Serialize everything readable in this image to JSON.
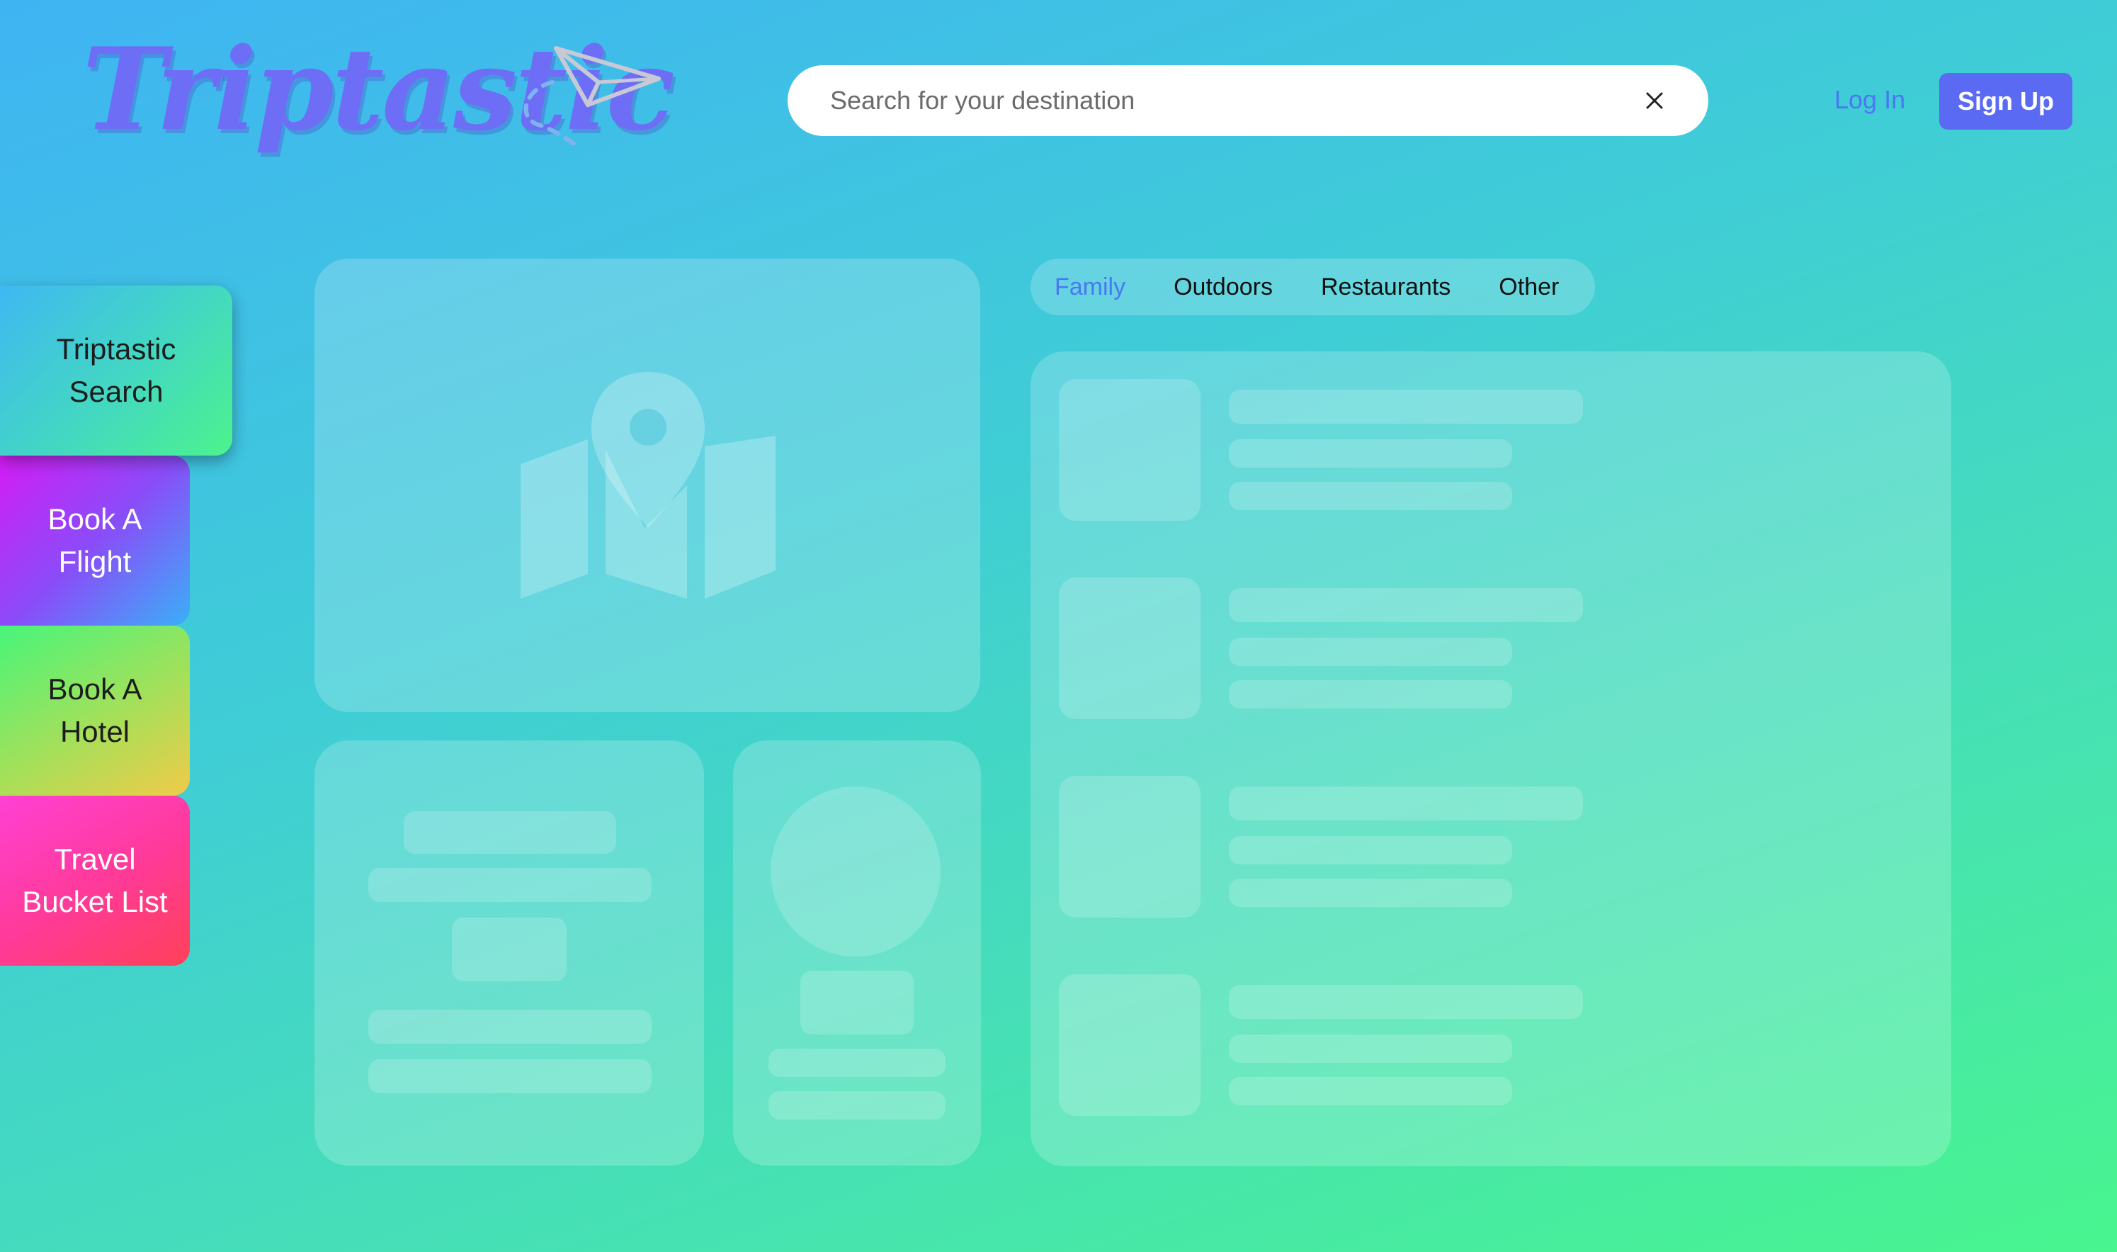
{
  "header": {
    "logo_text": "Triptastic",
    "search": {
      "placeholder": "Search for your destination",
      "value": ""
    },
    "login_label": "Log In",
    "signup_label": "Sign Up"
  },
  "sidebar": {
    "items": [
      {
        "label": "Triptastic Search",
        "active": true
      },
      {
        "label": "Book A Flight"
      },
      {
        "label": "Book A Hotel"
      },
      {
        "label": "Travel Bucket List"
      }
    ]
  },
  "categories": {
    "tabs": [
      {
        "label": "Family",
        "active": true
      },
      {
        "label": "Outdoors"
      },
      {
        "label": "Restaurants"
      },
      {
        "label": "Other"
      }
    ]
  },
  "colors": {
    "accent": "#5a6af2",
    "link": "#4a78f0",
    "logo": "#6d6ef5"
  },
  "icons": [
    "paper-plane-icon",
    "close-icon",
    "map-pin-icon"
  ]
}
